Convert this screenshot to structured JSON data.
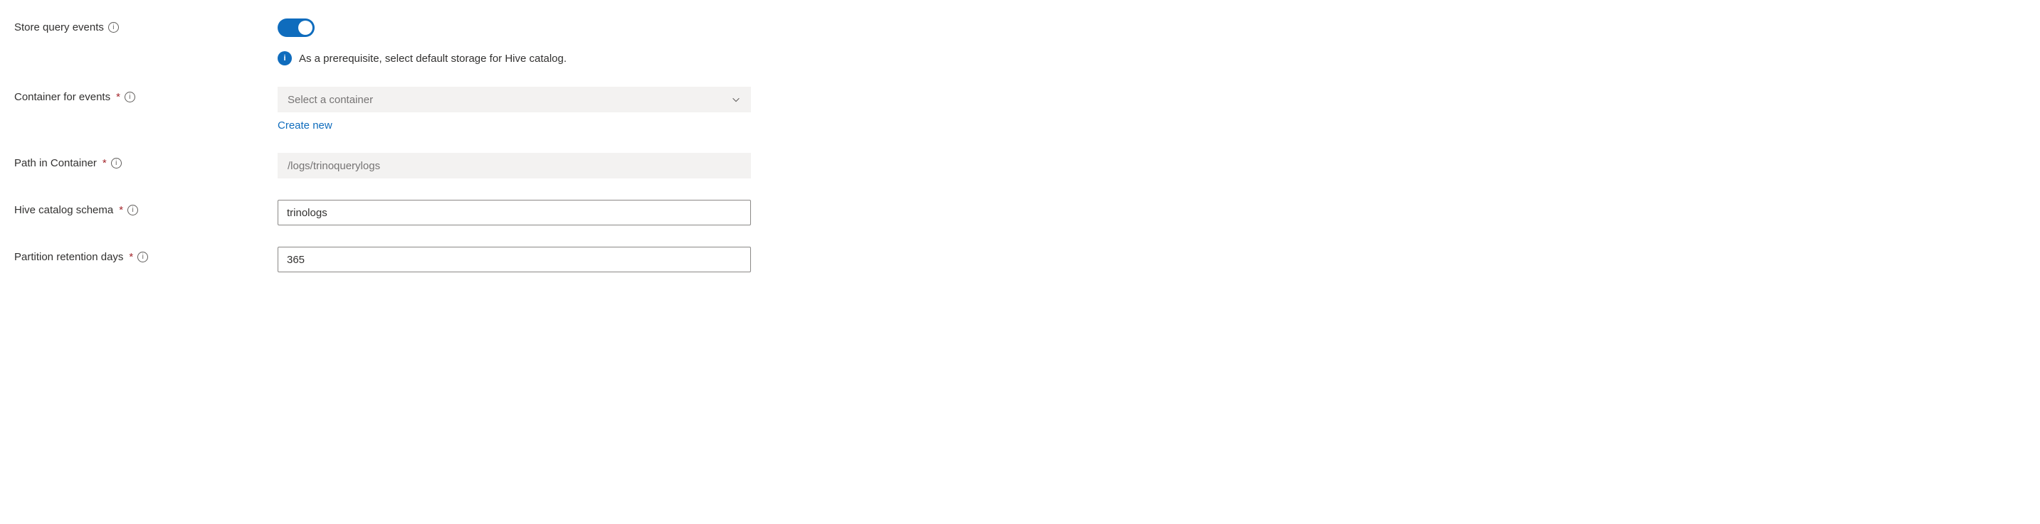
{
  "storeQueryEvents": {
    "label": "Store query events",
    "enabled": true,
    "info_message": "As a prerequisite, select default storage for Hive catalog."
  },
  "containerForEvents": {
    "label": "Container for events",
    "placeholder": "Select a container",
    "createNew": "Create new"
  },
  "pathInContainer": {
    "label": "Path in Container",
    "placeholder": "/logs/trinoquerylogs"
  },
  "hiveCatalogSchema": {
    "label": "Hive catalog schema",
    "value": "trinologs"
  },
  "partitionRetentionDays": {
    "label": "Partition retention days",
    "value": "365"
  },
  "icons": {
    "info_glyph": "i"
  },
  "required_mark": "*"
}
